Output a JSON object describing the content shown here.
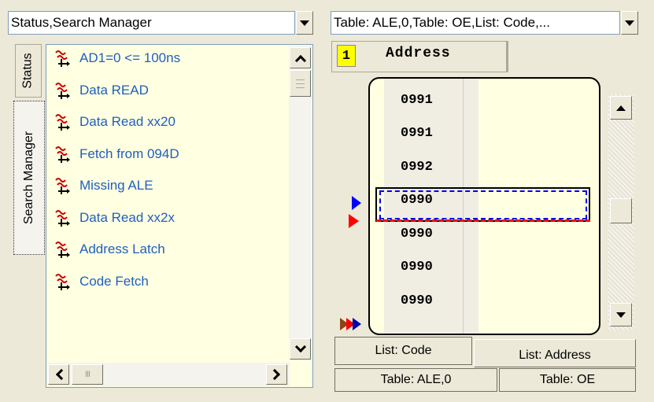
{
  "left_panel": {
    "combo_value": "Status,Search Manager",
    "side_tabs": [
      {
        "label": "Status"
      },
      {
        "label": "Search Manager"
      }
    ],
    "items": [
      {
        "label": "AD1=0 <= 100ns",
        "icon": "search-trigger-icon"
      },
      {
        "label": "Data READ",
        "icon": "search-trigger-icon"
      },
      {
        "label": "Data Read xx20",
        "icon": "search-trigger-icon"
      },
      {
        "label": "Fetch from 094D",
        "icon": "search-trigger-icon"
      },
      {
        "label": "Missing ALE",
        "icon": "search-trigger-icon"
      },
      {
        "label": "Data Read xx2x",
        "icon": "search-trigger-icon"
      },
      {
        "label": "Address Latch",
        "icon": "search-trigger-icon"
      },
      {
        "label": "Code Fetch",
        "icon": "search-trigger-icon"
      }
    ],
    "hscroll_grip": "III"
  },
  "right_panel": {
    "combo_value": "Table: ALE,0,Table: OE,List: Code,...",
    "column_index": "1",
    "column_header": "Address",
    "rows": [
      "0991",
      "0991",
      "0992",
      "0990",
      "0990",
      "0990",
      "0990"
    ],
    "selected_row": 3,
    "bottom_tabs_row1": [
      "List: Code",
      "List: Address"
    ],
    "bottom_tabs_row2": [
      "Table: ALE,0",
      "Table: OE"
    ]
  },
  "colors": {
    "background": "#ece9d8",
    "list_background": "#ffffe1",
    "item_text": "#1f5fbf",
    "index_badge": "#ffff00",
    "cursor_blue": "#0000ff",
    "cursor_red": "#ff0000"
  }
}
